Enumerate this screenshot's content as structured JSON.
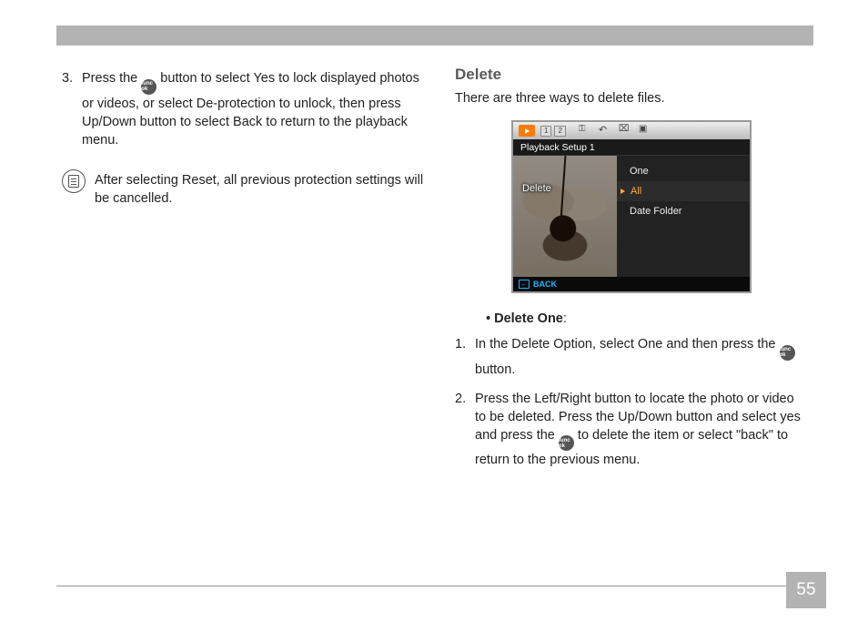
{
  "page_number": "55",
  "left": {
    "step3_num": "3.",
    "step3_a": "Press the ",
    "func_label": "func ok",
    "step3_b": " button to select Yes to lock displayed photos or videos, or select De-protection to unlock, then press Up/Down button to select Back to return to the playback menu.",
    "note": "After selecting Reset, all previous protection settings will be cancelled."
  },
  "right": {
    "heading": "Delete",
    "intro": "There are three ways to delete files.",
    "bullet_label": "Delete One",
    "bullet_colon": ":",
    "steps": [
      {
        "num": "1.",
        "a": "In the Delete Option, select One and then press the ",
        "b": " button."
      },
      {
        "num": "2.",
        "a": "Press the Left/Right button to locate the photo or video to be deleted. Press the Up/Down button and select yes and press the ",
        "b": " to delete the item or select \"back\" to return to the previous menu."
      }
    ]
  },
  "screenshot": {
    "top_tabs": [
      "1",
      "2"
    ],
    "sub_title": "Playback Setup 1",
    "left_label": "Delete",
    "options": [
      "One",
      "All",
      "Date Folder"
    ],
    "selected_index": 1,
    "footer": "BACK"
  }
}
